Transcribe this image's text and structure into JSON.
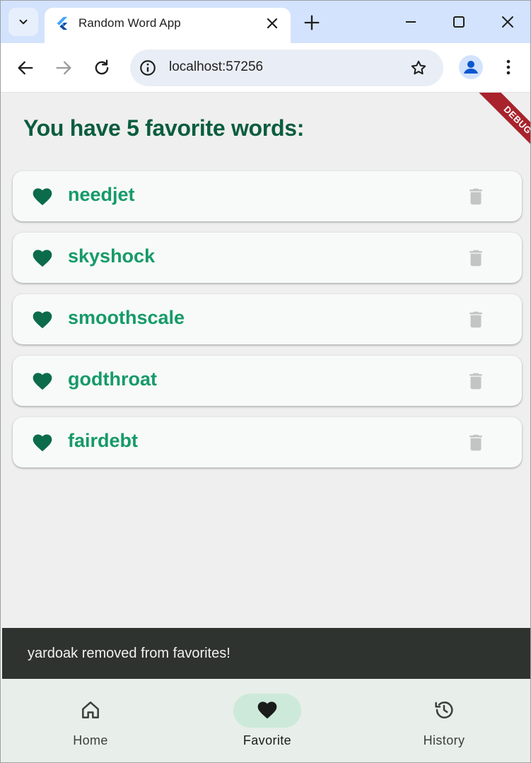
{
  "browser": {
    "tab_title": "Random Word App",
    "url": "localhost:57256",
    "icons": {
      "tab_search": "chevron-down-icon",
      "favicon": "flutter-icon",
      "tab_close": "close-icon",
      "new_tab": "plus-icon",
      "back": "arrow-left-icon",
      "forward": "arrow-right-icon",
      "reload": "reload-icon",
      "site_info": "info-icon",
      "bookmark": "star-icon",
      "profile": "person-icon",
      "menu": "kebab-icon"
    }
  },
  "debug_banner": "DEBUG",
  "favorites": {
    "heading": "You have 5 favorite words:",
    "items": [
      {
        "word": "needjet"
      },
      {
        "word": "skyshock"
      },
      {
        "word": "smoothscale"
      },
      {
        "word": "godthroat"
      },
      {
        "word": "fairdebt"
      }
    ]
  },
  "snackbar": {
    "message": "yardoak removed from favorites!"
  },
  "bottom_nav": {
    "items": [
      {
        "label": "Home",
        "icon": "home-icon",
        "active": false
      },
      {
        "label": "Favorite",
        "icon": "heart-icon",
        "active": true
      },
      {
        "label": "History",
        "icon": "history-icon",
        "active": false
      }
    ]
  },
  "colors": {
    "heading": "#0b5d3f",
    "word": "#169a68",
    "heart": "#0b6b4a",
    "trash": "#c4c4c4",
    "active_indicator": "#cde9da",
    "snackbar": "#2f3330"
  }
}
